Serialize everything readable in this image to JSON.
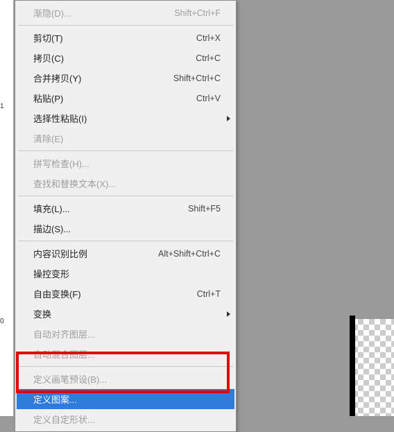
{
  "ruler": {
    "tick0": "1",
    "tick1": "0"
  },
  "menu": {
    "fade": {
      "label": "渐隐(D)...",
      "shortcut": "Shift+Ctrl+F"
    },
    "cut": {
      "label": "剪切(T)",
      "shortcut": "Ctrl+X"
    },
    "copy": {
      "label": "拷贝(C)",
      "shortcut": "Ctrl+C"
    },
    "copy_merged": {
      "label": "合并拷贝(Y)",
      "shortcut": "Shift+Ctrl+C"
    },
    "paste": {
      "label": "粘贴(P)",
      "shortcut": "Ctrl+V"
    },
    "paste_special": {
      "label": "选择性粘贴(I)"
    },
    "clear": {
      "label": "清除(E)"
    },
    "spellcheck": {
      "label": "拼写检查(H)..."
    },
    "find_replace": {
      "label": "查找和替换文本(X)..."
    },
    "fill": {
      "label": "填充(L)...",
      "shortcut": "Shift+F5"
    },
    "stroke": {
      "label": "描边(S)..."
    },
    "content_aware_scale": {
      "label": "内容识别比例",
      "shortcut": "Alt+Shift+Ctrl+C"
    },
    "puppet_warp": {
      "label": "操控变形"
    },
    "free_transform": {
      "label": "自由变换(F)",
      "shortcut": "Ctrl+T"
    },
    "transform": {
      "label": "变换"
    },
    "auto_align": {
      "label": "自动对齐图层..."
    },
    "auto_blend": {
      "label": "自动混合图层..."
    },
    "define_brush": {
      "label": "定义画笔预设(B)..."
    },
    "define_pattern": {
      "label": "定义图案..."
    },
    "define_shape": {
      "label": "定义自定形状..."
    }
  }
}
